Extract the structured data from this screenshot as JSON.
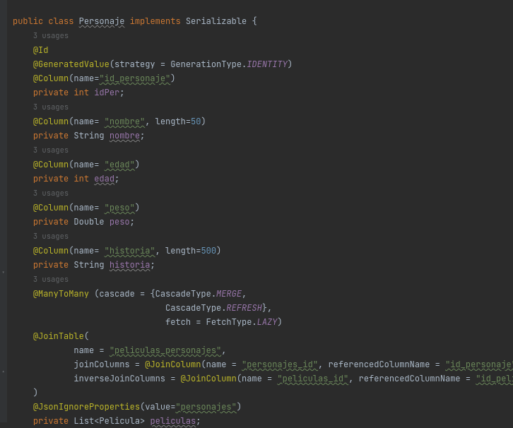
{
  "decl": {
    "public": "public",
    "class": "class",
    "name": "Personaje",
    "implements": "implements",
    "iface": "Serializable",
    "brace": "{"
  },
  "usages": "3 usages",
  "ann": {
    "Id": "@Id",
    "GeneratedValue": "@GeneratedValue",
    "Column": "@Column",
    "ManyToMany": "@ManyToMany",
    "JoinTable": "@JoinTable",
    "JoinColumn": "@JoinColumn",
    "JsonIgnoreProperties": "@JsonIgnoreProperties"
  },
  "gv": {
    "open": "(strategy = GenerationType.",
    "identity": "IDENTITY",
    "close": ")"
  },
  "col": {
    "nameEq": "(name=",
    "nameEqSp": "(name= ",
    "lenEq": ", length=",
    "close": ")"
  },
  "strings": {
    "id_personaje": "\"id_personaje\"",
    "nombre": "\"nombre\"",
    "edad": "\"edad\"",
    "peso": "\"peso\"",
    "historia": "\"historia\"",
    "peliculas_personajes": "\"peliculas_personajes\"",
    "personajes_id": "\"personajes_id\"",
    "id_personaje2": "\"id_personaje\"",
    "peliculas_id": "\"peliculas_id\"",
    "id_peli": "\"id_peli\"",
    "personajes": "\"personajes\""
  },
  "nums": {
    "fifty": "50",
    "fivehundred": "500"
  },
  "priv": "private",
  "types": {
    "int": "int",
    "String": "String",
    "Double": "Double",
    "ListPelicula": "List<Pelicula>"
  },
  "fields": {
    "idPer": "idPer",
    "nombre": "nombre",
    "edad": "edad",
    "peso": "peso",
    "historia": "historia",
    "peliculas": "peliculas"
  },
  "mtm": {
    "open": " (cascade = {CascadeType.",
    "merge": "MERGE",
    "comma": ",",
    "cascade2": "CascadeType.",
    "refresh": "REFRESH",
    "braceComma": "},",
    "fetchEq": "fetch = FetchType.",
    "lazy": "LAZY",
    "close": ")"
  },
  "jt": {
    "open": "(",
    "nameEq": "name = ",
    "comma": ",",
    "joinColsEq": "joinColumns = ",
    "jcOpenNameEq": "(name = ",
    "refColEq": ", referencedColumnName = ",
    "closeComma": "),",
    "invJoinEq": "inverseJoinColumns = ",
    "close": ")"
  },
  "jip": {
    "open": "(value=",
    "close": ")"
  },
  "semi": ";"
}
